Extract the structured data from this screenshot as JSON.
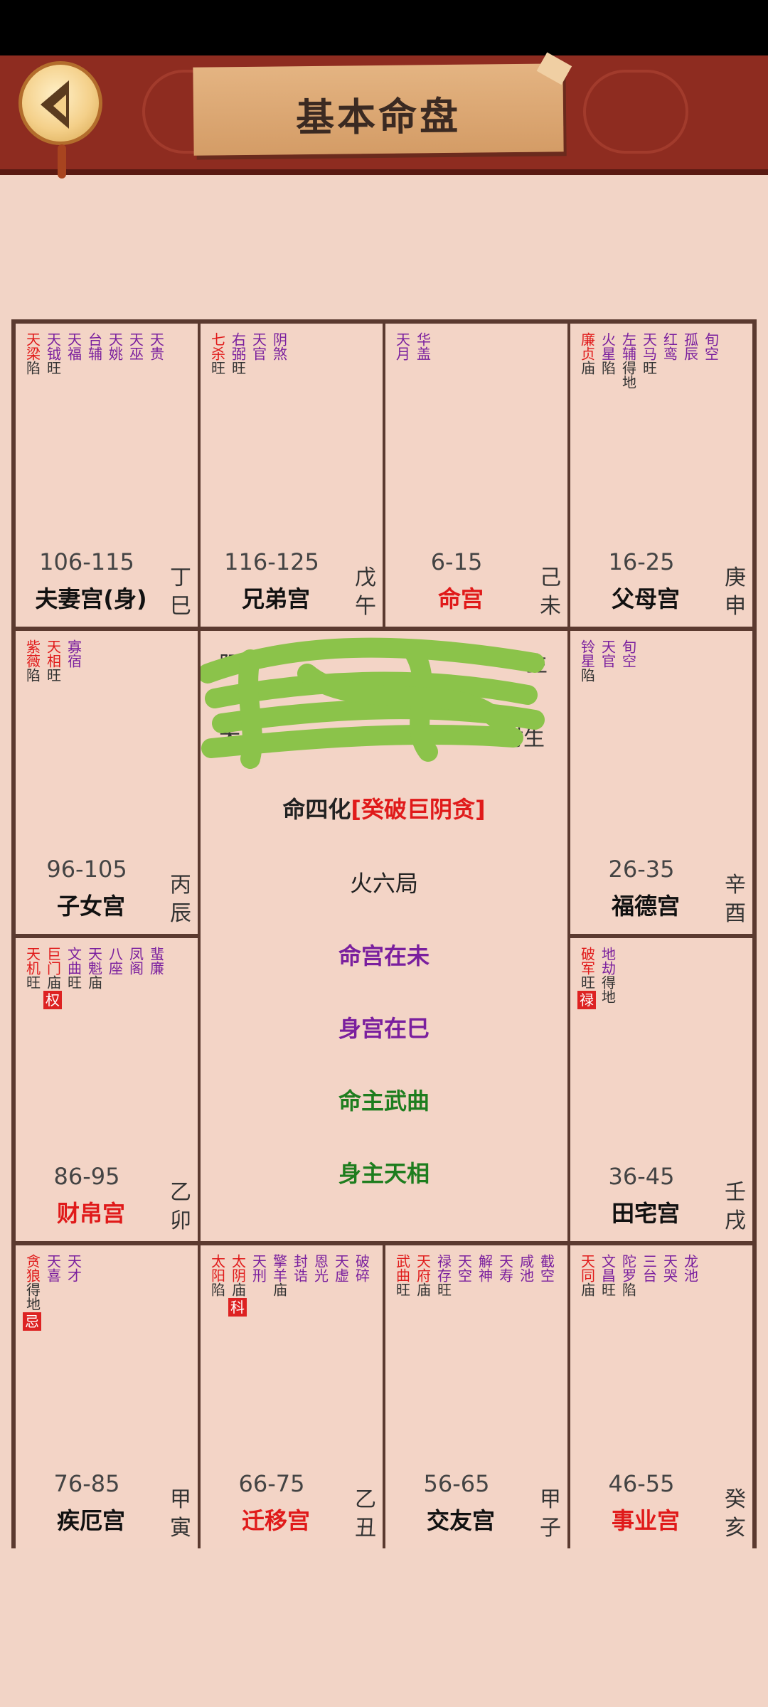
{
  "header": {
    "title": "基本命盘",
    "back_icon": "back-chevron-icon"
  },
  "center": {
    "hua_label": "命四化",
    "hua_value": "[癸破巨阴贪]",
    "ju": "火六局",
    "ming_gong": "命宫在未",
    "shen_gong": "身宫在巳",
    "ming_zhu": "命主武曲",
    "shen_zhu": "身主天相",
    "visible_fragments": [
      "阳",
      "生",
      "太",
      "时生"
    ]
  },
  "colors": {
    "red": "#e01a1a",
    "purple": "#7a1f9e",
    "green": "#1e7d1e",
    "scribble": "#8bc34a"
  },
  "cells": [
    {
      "stars": [
        {
          "n": "天梁",
          "c": "red",
          "b": "陷"
        },
        {
          "n": "天钺",
          "c": "purple",
          "b": "旺"
        },
        {
          "n": "天福",
          "c": "purple",
          "b": ""
        },
        {
          "n": "台辅",
          "c": "purple",
          "b": ""
        },
        {
          "n": "天姚",
          "c": "purple",
          "b": ""
        },
        {
          "n": "天巫",
          "c": "purple",
          "b": ""
        },
        {
          "n": "天贵",
          "c": "purple",
          "b": ""
        }
      ],
      "age": "106-115",
      "palace": "夫妻宫(身)",
      "palace_red": false,
      "gz": [
        "丁",
        "巳"
      ]
    },
    {
      "stars": [
        {
          "n": "七杀",
          "c": "red",
          "b": "旺"
        },
        {
          "n": "右弼",
          "c": "purple",
          "b": "旺"
        },
        {
          "n": "天官",
          "c": "purple",
          "b": ""
        },
        {
          "n": "阴煞",
          "c": "purple",
          "b": ""
        }
      ],
      "age": "116-125",
      "palace": "兄弟宫",
      "palace_red": false,
      "gz": [
        "戊",
        "午"
      ]
    },
    {
      "stars": [
        {
          "n": "天月",
          "c": "purple",
          "b": ""
        },
        {
          "n": "华盖",
          "c": "purple",
          "b": ""
        }
      ],
      "age": "6-15",
      "palace": "命宫",
      "palace_red": true,
      "gz": [
        "己",
        "未"
      ]
    },
    {
      "stars": [
        {
          "n": "廉贞",
          "c": "red",
          "b": "庙"
        },
        {
          "n": "火星",
          "c": "purple",
          "b": "陷"
        },
        {
          "n": "左辅",
          "c": "purple",
          "b": "得地"
        },
        {
          "n": "天马",
          "c": "purple",
          "b": "旺"
        },
        {
          "n": "红鸾",
          "c": "purple",
          "b": ""
        },
        {
          "n": "孤辰",
          "c": "purple",
          "b": ""
        },
        {
          "n": "旬空",
          "c": "purple",
          "b": ""
        }
      ],
      "age": "16-25",
      "palace": "父母宫",
      "palace_red": false,
      "gz": [
        "庚",
        "申"
      ]
    },
    {
      "stars": [
        {
          "n": "紫薇",
          "c": "red",
          "b": "陷"
        },
        {
          "n": "天相",
          "c": "red",
          "b": "旺"
        },
        {
          "n": "寡宿",
          "c": "purple",
          "b": ""
        }
      ],
      "age": "96-105",
      "palace": "子女宫",
      "palace_red": false,
      "gz": [
        "丙",
        "辰"
      ]
    },
    {
      "stars": [
        {
          "n": "铃星",
          "c": "purple",
          "b": "陷"
        },
        {
          "n": "天官",
          "c": "purple",
          "b": ""
        },
        {
          "n": "旬空",
          "c": "purple",
          "b": ""
        }
      ],
      "age": "26-35",
      "palace": "福德宫",
      "palace_red": false,
      "gz": [
        "辛",
        "酉"
      ]
    },
    {
      "stars": [
        {
          "n": "天机",
          "c": "red",
          "b": "旺"
        },
        {
          "n": "巨门",
          "c": "red",
          "b": "庙",
          "hua": "权"
        },
        {
          "n": "文曲",
          "c": "purple",
          "b": "旺"
        },
        {
          "n": "天魁",
          "c": "purple",
          "b": "庙"
        },
        {
          "n": "八座",
          "c": "purple",
          "b": ""
        },
        {
          "n": "凤阁",
          "c": "purple",
          "b": ""
        },
        {
          "n": "蜚廉",
          "c": "purple",
          "b": ""
        }
      ],
      "age": "86-95",
      "palace": "财帛宫",
      "palace_red": true,
      "gz": [
        "乙",
        "卯"
      ]
    },
    {
      "stars": [
        {
          "n": "破军",
          "c": "red",
          "b": "旺",
          "hua": "禄"
        },
        {
          "n": "地劫",
          "c": "purple",
          "b": "得地"
        }
      ],
      "age": "36-45",
      "palace": "田宅宫",
      "palace_red": false,
      "gz": [
        "壬",
        "戌"
      ]
    },
    {
      "stars": [
        {
          "n": "贪狼",
          "c": "red",
          "b": "得地",
          "hua": "忌"
        },
        {
          "n": "天喜",
          "c": "purple",
          "b": ""
        },
        {
          "n": "天才",
          "c": "purple",
          "b": ""
        }
      ],
      "age": "76-85",
      "palace": "疾厄宫",
      "palace_red": false,
      "gz": [
        "甲",
        "寅"
      ]
    },
    {
      "stars": [
        {
          "n": "太阳",
          "c": "red",
          "b": "陷"
        },
        {
          "n": "太阴",
          "c": "red",
          "b": "庙",
          "hua": "科"
        },
        {
          "n": "天刑",
          "c": "purple",
          "b": ""
        },
        {
          "n": "擎羊",
          "c": "purple",
          "b": "庙"
        },
        {
          "n": "封诰",
          "c": "purple",
          "b": ""
        },
        {
          "n": "恩光",
          "c": "purple",
          "b": ""
        },
        {
          "n": "天虚",
          "c": "purple",
          "b": ""
        },
        {
          "n": "破碎",
          "c": "purple",
          "b": ""
        }
      ],
      "age": "66-75",
      "palace": "迁移宫",
      "palace_red": true,
      "gz": [
        "乙",
        "丑"
      ]
    },
    {
      "stars": [
        {
          "n": "武曲",
          "c": "red",
          "b": "旺"
        },
        {
          "n": "天府",
          "c": "red",
          "b": "庙"
        },
        {
          "n": "禄存",
          "c": "purple",
          "b": "旺"
        },
        {
          "n": "天空",
          "c": "purple",
          "b": ""
        },
        {
          "n": "解神",
          "c": "purple",
          "b": ""
        },
        {
          "n": "天寿",
          "c": "purple",
          "b": ""
        },
        {
          "n": "咸池",
          "c": "purple",
          "b": ""
        },
        {
          "n": "截空",
          "c": "purple",
          "b": ""
        }
      ],
      "age": "56-65",
      "palace": "交友宫",
      "palace_red": false,
      "gz": [
        "甲",
        "子"
      ]
    },
    {
      "stars": [
        {
          "n": "天同",
          "c": "red",
          "b": "庙"
        },
        {
          "n": "文昌",
          "c": "purple",
          "b": "旺"
        },
        {
          "n": "陀罗",
          "c": "purple",
          "b": "陷"
        },
        {
          "n": "三台",
          "c": "purple",
          "b": ""
        },
        {
          "n": "天哭",
          "c": "purple",
          "b": ""
        },
        {
          "n": "龙池",
          "c": "purple",
          "b": ""
        }
      ],
      "age": "46-55",
      "palace": "事业宫",
      "palace_red": true,
      "gz": [
        "癸",
        "亥"
      ]
    }
  ]
}
